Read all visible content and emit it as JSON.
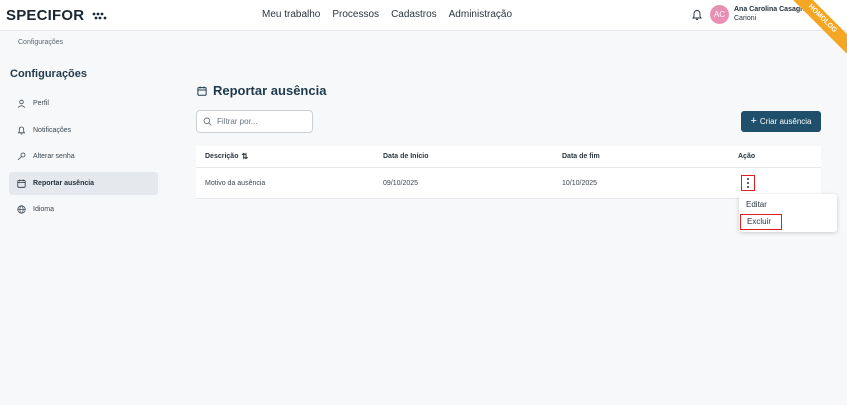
{
  "header": {
    "logo_text": "SPECIFOR",
    "nav": [
      "Meu trabalho",
      "Processos",
      "Cadastros",
      "Administração"
    ],
    "user_initials": "AC",
    "user_name_line1": "Ana Carolina Casagrande",
    "user_name_line2": "Carioni",
    "env_ribbon": "HOMOLOG",
    "icons": {
      "notifications": "bell-icon"
    }
  },
  "breadcrumb": "Configurações",
  "sidebar": {
    "title": "Configurações",
    "items": [
      {
        "label": "Perfil",
        "icon": "user-icon",
        "active": false
      },
      {
        "label": "Notificações",
        "icon": "bell-icon",
        "active": false
      },
      {
        "label": "Alterar senha",
        "icon": "key-icon",
        "active": false
      },
      {
        "label": "Reportar ausência",
        "icon": "calendar-icon",
        "active": true
      },
      {
        "label": "Idioma",
        "icon": "globe-icon",
        "active": false
      }
    ]
  },
  "main": {
    "title": "Reportar ausência",
    "search_placeholder": "Filtrar por...",
    "create_button": "Criar ausência",
    "table": {
      "columns": [
        "Descrição",
        "Data de Início",
        "Data de fim",
        "Ação"
      ],
      "rows": [
        {
          "descricao": "Motivo da ausência",
          "inicio": "09/10/2025",
          "fim": "10/10/2025"
        }
      ]
    },
    "action_menu": {
      "items": [
        "Editar",
        "Excluir"
      ]
    }
  },
  "colors": {
    "primary": "#1f4f6b",
    "ribbon": "#f5a623",
    "highlight": "#e02020",
    "avatar": "#e98fb3"
  }
}
